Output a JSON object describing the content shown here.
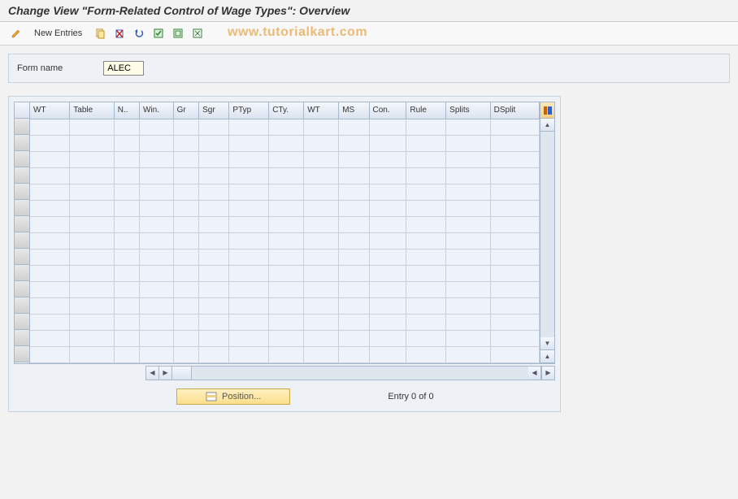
{
  "title": "Change View \"Form-Related Control of Wage Types\": Overview",
  "toolbar": {
    "new_entries_label": "New Entries"
  },
  "watermark": "www.tutorialkart.com",
  "form": {
    "name_label": "Form name",
    "name_value": "ALEC"
  },
  "table": {
    "columns": [
      "WT",
      "Table",
      "N..",
      "Win.",
      "Gr",
      "Sgr",
      "PTyp",
      "CTy.",
      "WT",
      "MS",
      "Con.",
      "Rule",
      "Splits",
      "DSplit"
    ],
    "row_count": 15
  },
  "footer": {
    "position_label": "Position...",
    "entry_text": "Entry 0 of 0"
  }
}
